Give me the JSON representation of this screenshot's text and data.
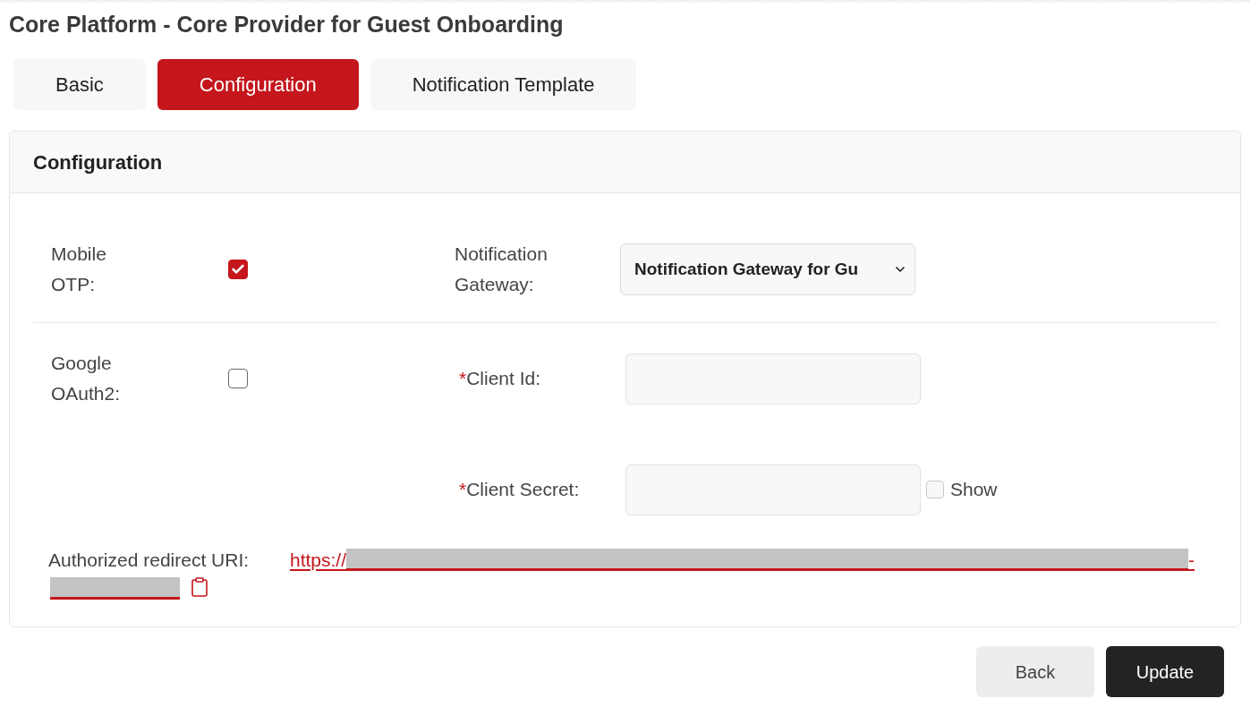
{
  "page_title": "Core Platform - Core Provider for Guest Onboarding",
  "tabs": [
    {
      "label": "Basic",
      "selected": false
    },
    {
      "label": "Configuration",
      "selected": true
    },
    {
      "label": "Notification Template",
      "selected": false
    }
  ],
  "panel": {
    "title": "Configuration",
    "rows": [
      {
        "label": "Mobile OTP:",
        "checked": true,
        "fields": [
          {
            "kind": "select",
            "label": "Notification Gateway:",
            "value": "Notification Gateway for Gu"
          }
        ]
      },
      {
        "label": "Google OAuth2:",
        "checked": false,
        "fields": [
          {
            "kind": "input",
            "required_mark": "*",
            "label": "Client Id:"
          },
          {
            "kind": "input",
            "required_mark": "*",
            "label": "Client Secret:",
            "show": {
              "label": "Show",
              "checked": false
            }
          }
        ]
      }
    ],
    "redirect_uri": {
      "label": "Authorized redirect URI:",
      "link_start": "https://",
      "link_end": "-"
    }
  },
  "buttons": [
    {
      "label": "Back",
      "kind": "secondary"
    },
    {
      "label": "Update",
      "kind": "primary"
    }
  ]
}
